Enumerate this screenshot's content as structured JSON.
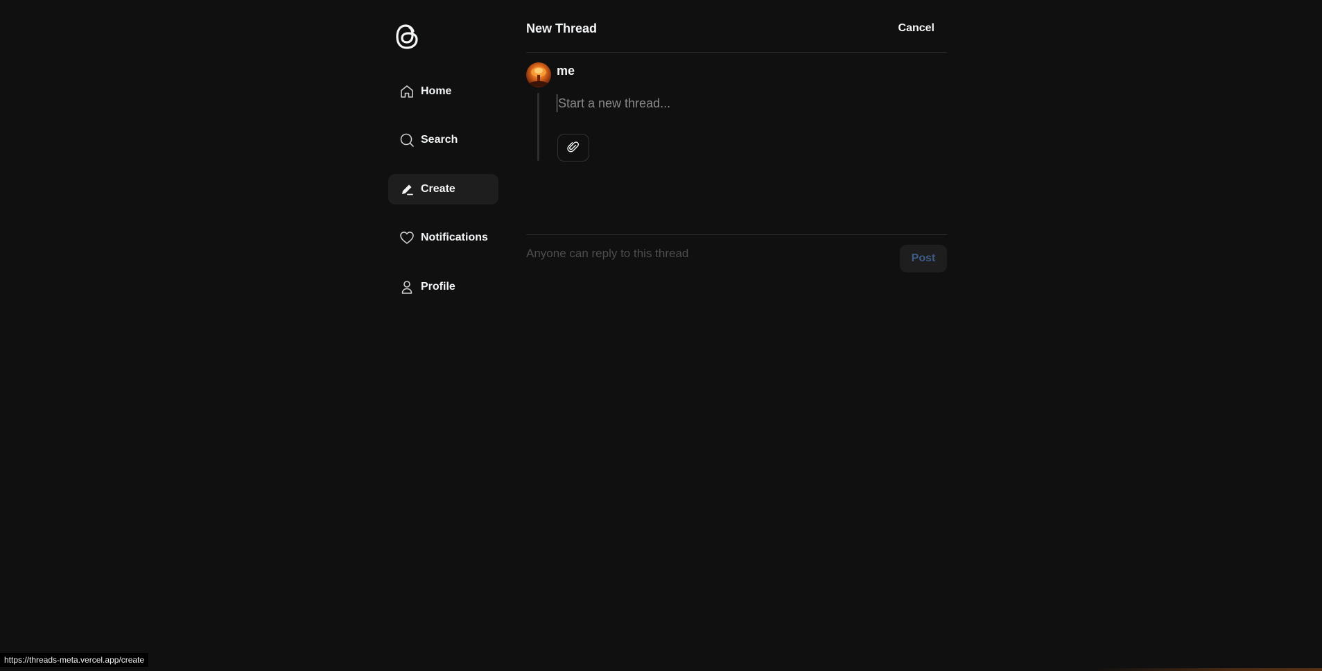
{
  "sidebar": {
    "logo_icon": "threads-logo-icon",
    "items": [
      {
        "label": "Home",
        "icon": "home-icon",
        "active": false
      },
      {
        "label": "Search",
        "icon": "search-icon",
        "active": false
      },
      {
        "label": "Create",
        "icon": "create-pencil-icon",
        "active": true
      },
      {
        "label": "Notifications",
        "icon": "heart-icon",
        "active": false
      },
      {
        "label": "Profile",
        "icon": "user-icon",
        "active": false
      }
    ]
  },
  "header": {
    "title": "New Thread",
    "cancel_label": "Cancel"
  },
  "composer": {
    "username": "me",
    "placeholder": "Start a new thread...",
    "value": "",
    "attach_icon": "paperclip-icon"
  },
  "footer": {
    "reply_setting": "Anyone can reply to this thread",
    "post_label": "Post"
  },
  "status_bar": {
    "url": "https://threads-meta.vercel.app/create"
  },
  "colors": {
    "background": "#101010",
    "text": "#f3f5f7",
    "active_nav_bg": "#1e1e1e",
    "post_text_disabled": "#3e5c86",
    "muted_text": "#4d4d4d"
  }
}
